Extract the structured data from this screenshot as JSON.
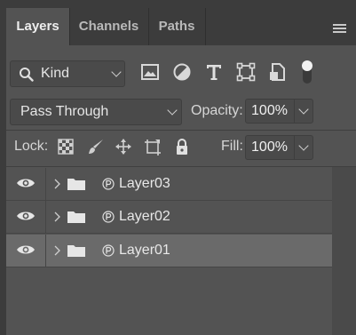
{
  "tabs": [
    {
      "label": "Layers",
      "active": true
    },
    {
      "label": "Channels",
      "active": false
    },
    {
      "label": "Paths",
      "active": false
    }
  ],
  "panel_menu_icon": "hamburger-menu-icon",
  "filter": {
    "kind_label": "Kind",
    "icons": [
      "image-filter-icon",
      "adjustment-filter-icon",
      "type-filter-icon",
      "shape-filter-icon",
      "smart-object-filter-icon",
      "filter-toggle-icon"
    ]
  },
  "blend": {
    "mode": "Pass Through"
  },
  "opacity": {
    "label": "Opacity:",
    "value": "100%"
  },
  "lock": {
    "label": "Lock:",
    "icons": [
      "lock-transparent-pixels-icon",
      "lock-image-pixels-icon",
      "lock-position-icon",
      "lock-artboard-icon",
      "lock-all-icon"
    ]
  },
  "fill": {
    "label": "Fill:",
    "value": "100%"
  },
  "layers": [
    {
      "name": "Layer03",
      "visible": true,
      "selected": false,
      "type": "group"
    },
    {
      "name": "Layer02",
      "visible": true,
      "selected": false,
      "type": "group"
    },
    {
      "name": "Layer01",
      "visible": true,
      "selected": true,
      "type": "group"
    }
  ],
  "colors": {
    "panel_bg": "#535353",
    "tab_bg": "#3c3c3c",
    "selected_row": "#6a6a6a"
  }
}
